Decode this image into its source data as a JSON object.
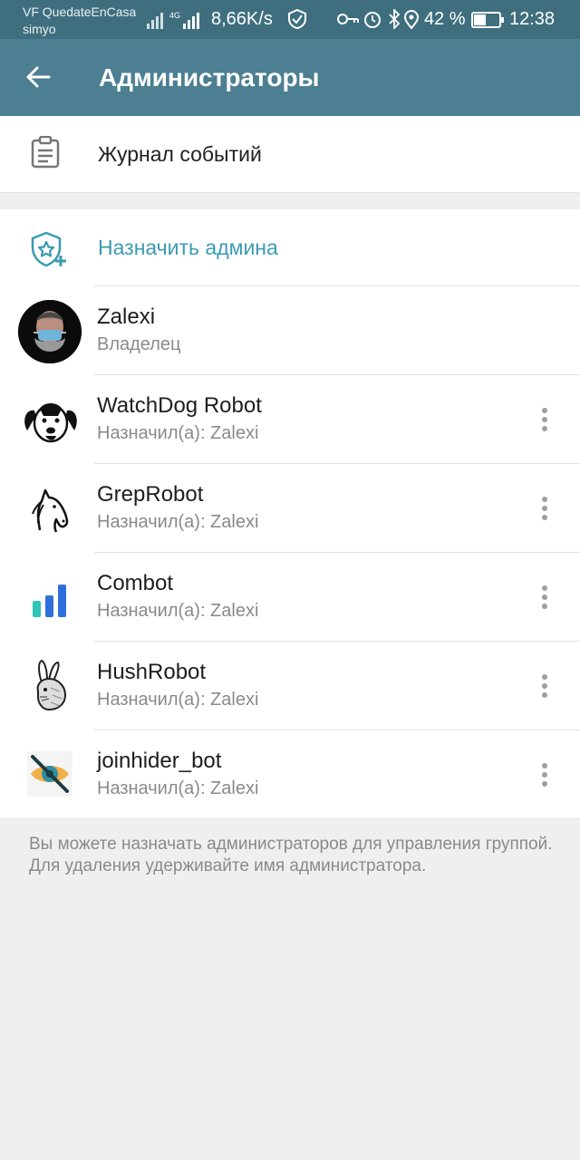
{
  "status_bar": {
    "carrier_line1": "VF QuedateEnCasa",
    "carrier_line2": "simyo",
    "speed": "8,66K/s",
    "battery_percent": "42 %",
    "time": "12:38"
  },
  "app_bar": {
    "title": "Администраторы"
  },
  "event_log": {
    "label": "Журнал событий"
  },
  "assign_admin": {
    "label": "Назначить админа"
  },
  "admins": [
    {
      "name": "Zalexi",
      "role": "Владелец",
      "avatar": "person-avatar"
    },
    {
      "name": "WatchDog Robot",
      "role": "Назначил(а): Zalexi",
      "avatar": "dog-avatar"
    },
    {
      "name": "GrepRobot",
      "role": "Назначил(а): Zalexi",
      "avatar": "horse-avatar"
    },
    {
      "name": "Combot",
      "role": "Назначил(а): Zalexi",
      "avatar": "bar-chart-avatar"
    },
    {
      "name": "HushRobot",
      "role": "Назначил(а): Zalexi",
      "avatar": "rabbit-avatar"
    },
    {
      "name": "joinhider_bot",
      "role": "Назначил(а): Zalexi",
      "avatar": "eye-avatar"
    }
  ],
  "footer": {
    "line1": "Вы можете назначать администраторов для управления группой.",
    "line2": "Для удаления удерживайте имя администратора."
  },
  "colors": {
    "status_bar": "#3f6f7f",
    "app_bar": "#4b7f91",
    "accent": "#3a9bb1"
  }
}
